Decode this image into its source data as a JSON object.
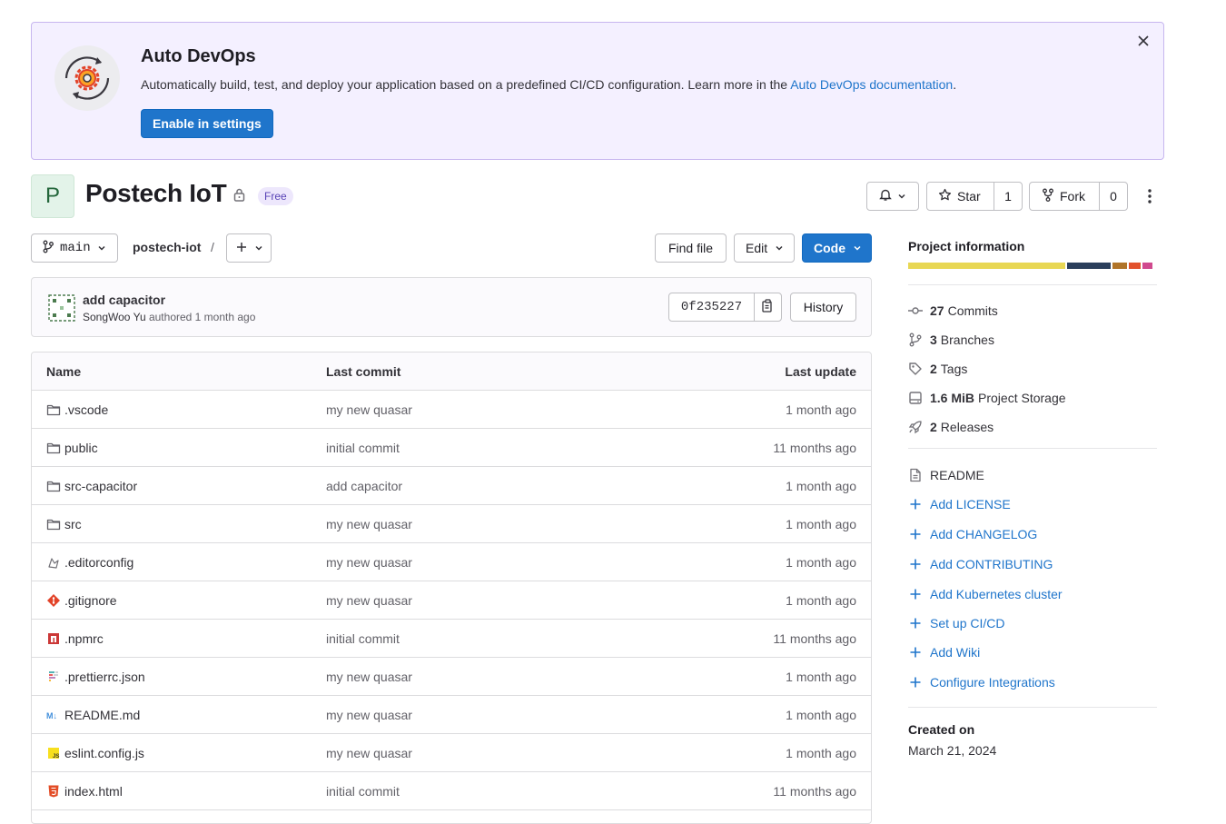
{
  "banner": {
    "title": "Auto DevOps",
    "text_prefix": "Automatically build, test, and deploy your application based on a predefined CI/CD configuration. Learn more in the ",
    "link_text": "Auto DevOps documentation",
    "text_suffix": ".",
    "button_label": "Enable in settings"
  },
  "project": {
    "avatar_letter": "P",
    "name": "Postech IoT",
    "tier_badge": "Free",
    "star_label": "Star",
    "star_count": "1",
    "fork_label": "Fork",
    "fork_count": "0"
  },
  "repo": {
    "branch": "main",
    "path": "postech-iot",
    "path_separator": "/",
    "find_file": "Find file",
    "edit": "Edit",
    "code": "Code"
  },
  "commit": {
    "title": "add capacitor",
    "author": "SongWoo Yu",
    "authored": " authored 1 month ago",
    "sha": "0f235227",
    "history": "History"
  },
  "files": {
    "headers": {
      "name": "Name",
      "last_commit": "Last commit",
      "last_update": "Last update"
    },
    "rows": [
      {
        "name": ".vscode",
        "icon": "folder-icon",
        "commit": "my new quasar",
        "updated": "1 month ago"
      },
      {
        "name": "public",
        "icon": "folder-icon",
        "commit": "initial commit",
        "updated": "11 months ago"
      },
      {
        "name": "src-capacitor",
        "icon": "folder-icon",
        "commit": "add capacitor",
        "updated": "1 month ago"
      },
      {
        "name": "src",
        "icon": "folder-icon",
        "commit": "my new quasar",
        "updated": "1 month ago"
      },
      {
        "name": ".editorconfig",
        "icon": "editorconfig-icon",
        "commit": "my new quasar",
        "updated": "1 month ago"
      },
      {
        "name": ".gitignore",
        "icon": "git-icon",
        "commit": "my new quasar",
        "updated": "1 month ago"
      },
      {
        "name": ".npmrc",
        "icon": "npm-icon",
        "commit": "initial commit",
        "updated": "11 months ago"
      },
      {
        "name": ".prettierrc.json",
        "icon": "prettier-icon",
        "commit": "my new quasar",
        "updated": "1 month ago"
      },
      {
        "name": "README.md",
        "icon": "markdown-icon",
        "commit": "my new quasar",
        "updated": "1 month ago"
      },
      {
        "name": "eslint.config.js",
        "icon": "javascript-icon",
        "commit": "my new quasar",
        "updated": "1 month ago"
      },
      {
        "name": "index.html",
        "icon": "html-icon",
        "commit": "initial commit",
        "updated": "11 months ago"
      }
    ]
  },
  "sidebar": {
    "title": "Project information",
    "language_colors": [
      "#e8d754",
      "#2a3e5b",
      "#b07428",
      "#e2522d",
      "#d0498e"
    ],
    "language_shares": [
      0.65,
      0.18,
      0.06,
      0.05,
      0.04
    ],
    "stats": [
      {
        "icon": "commit-icon",
        "count": "27",
        "label": "Commits"
      },
      {
        "icon": "branch-icon",
        "count": "3",
        "label": "Branches"
      },
      {
        "icon": "tag-icon",
        "count": "2",
        "label": "Tags"
      },
      {
        "icon": "storage-icon",
        "count": "1.6 MiB",
        "label": "Project Storage"
      },
      {
        "icon": "rocket-icon",
        "count": "2",
        "label": "Releases"
      }
    ],
    "readme": "README",
    "links": [
      "Add LICENSE",
      "Add CHANGELOG",
      "Add CONTRIBUTING",
      "Add Kubernetes cluster",
      "Set up CI/CD",
      "Add Wiki",
      "Configure Integrations"
    ],
    "created_label": "Created on",
    "created_date": "March 21, 2024"
  }
}
